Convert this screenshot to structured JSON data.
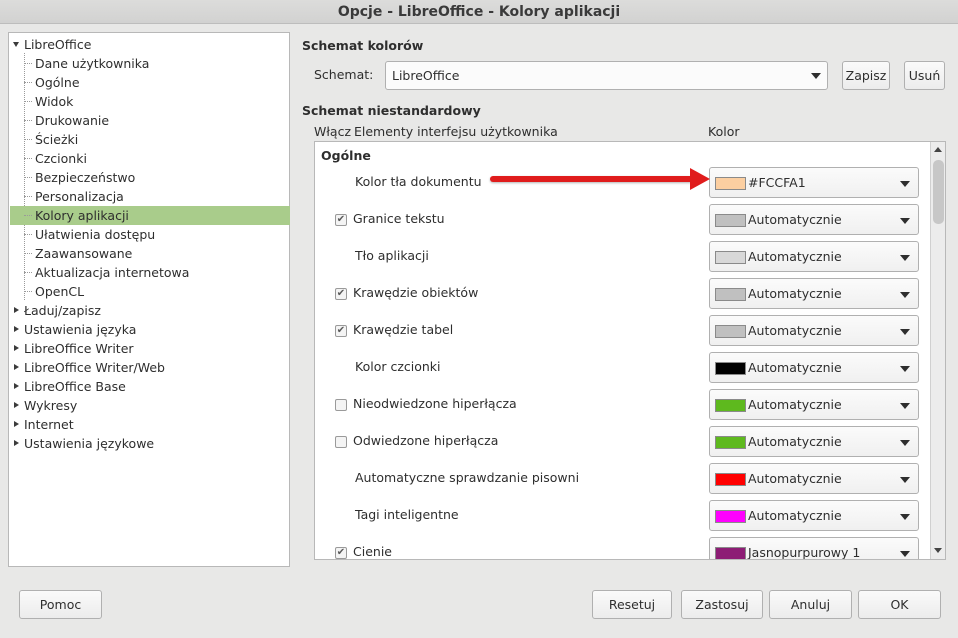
{
  "window": {
    "title": "Opcje - LibreOffice - Kolory aplikacji"
  },
  "tree": {
    "root": "LibreOffice",
    "children": [
      "Dane użytkownika",
      "Ogólne",
      "Widok",
      "Drukowanie",
      "Ścieżki",
      "Czcionki",
      "Bezpieczeństwo",
      "Personalizacja",
      "Kolory aplikacji",
      "Ułatwienia dostępu",
      "Zaawansowane",
      "Aktualizacja internetowa",
      "OpenCL"
    ],
    "selected": "Kolory aplikacji",
    "collapsed": [
      "Ładuj/zapisz",
      "Ustawienia języka",
      "LibreOffice Writer",
      "LibreOffice Writer/Web",
      "LibreOffice Base",
      "Wykresy",
      "Internet",
      "Ustawienia językowe"
    ]
  },
  "scheme": {
    "heading": "Schemat kolorów",
    "label": "Schemat:",
    "value": "LibreOffice",
    "save": "Zapisz",
    "delete": "Usuń"
  },
  "custom": {
    "heading": "Schemat niestandardowy",
    "col_enable": "Włącz",
    "col_elements": "Elementy interfejsu użytkownika",
    "col_color": "Kolor",
    "group": "Ogólne",
    "rows": [
      {
        "label": "Kolor tła dokumentu",
        "checkbox": null,
        "color_name": "#FCCFA1",
        "swatch": "#FCCFA1"
      },
      {
        "label": "Granice tekstu",
        "checkbox": true,
        "color_name": "Automatycznie",
        "swatch": "#c0c0c0"
      },
      {
        "label": "Tło aplikacji",
        "checkbox": null,
        "color_name": "Automatycznie",
        "swatch": "#d8d8d8"
      },
      {
        "label": "Krawędzie obiektów",
        "checkbox": true,
        "color_name": "Automatycznie",
        "swatch": "#c0c0c0"
      },
      {
        "label": "Krawędzie tabel",
        "checkbox": true,
        "color_name": "Automatycznie",
        "swatch": "#c0c0c0"
      },
      {
        "label": "Kolor czcionki",
        "checkbox": null,
        "color_name": "Automatycznie",
        "swatch": "#000000"
      },
      {
        "label": "Nieodwiedzone hiperłącza",
        "checkbox": false,
        "color_name": "Automatycznie",
        "swatch": "#5eb91e"
      },
      {
        "label": "Odwiedzone hiperłącza",
        "checkbox": false,
        "color_name": "Automatycznie",
        "swatch": "#5eb91e"
      },
      {
        "label": "Automatyczne sprawdzanie pisowni",
        "checkbox": null,
        "color_name": "Automatycznie",
        "swatch": "#ff0000"
      },
      {
        "label": "Tagi inteligentne",
        "checkbox": null,
        "color_name": "Automatycznie",
        "swatch": "#ff00ff"
      },
      {
        "label": "Cienie",
        "checkbox": true,
        "color_name": "Jasnopurpurowy 1",
        "swatch": "#8d1d75"
      }
    ]
  },
  "buttons": {
    "help": "Pomoc",
    "reset": "Resetuj",
    "apply": "Zastosuj",
    "cancel": "Anuluj",
    "ok": "OK"
  },
  "check_glyph": "✔"
}
